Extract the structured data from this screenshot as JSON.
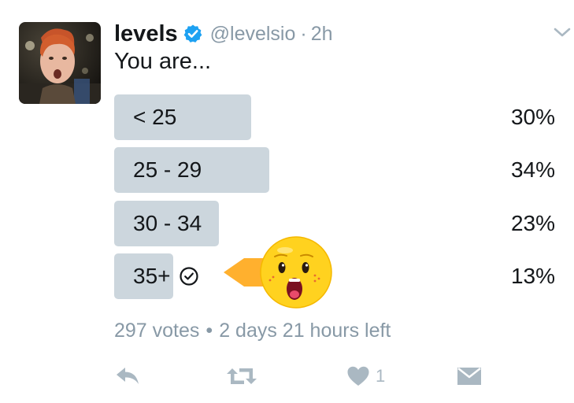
{
  "tweet": {
    "author_name": "levels",
    "author_handle": "@levelsio",
    "separator": "·",
    "time": "2h",
    "text": "You are..."
  },
  "poll": {
    "options": [
      {
        "label": "< 25",
        "percent_text": "30%",
        "fraction": 0.3,
        "selected": false
      },
      {
        "label": "25 - 29",
        "percent_text": "34%",
        "fraction": 0.34,
        "selected": false
      },
      {
        "label": "30 - 34",
        "percent_text": "23%",
        "fraction": 0.23,
        "selected": false
      },
      {
        "label": "35+",
        "percent_text": "13%",
        "fraction": 0.13,
        "selected": true
      }
    ],
    "votes": "297 votes",
    "bullet": "•",
    "time_left": "2 days 21 hours left"
  },
  "actions": {
    "like_count": "1"
  },
  "icons": {
    "verified": "verified-badge-icon",
    "caret": "chevron-down-icon",
    "selected": "check-circle-icon",
    "reply": "reply-icon",
    "retweet": "retweet-icon",
    "like": "heart-icon",
    "dm": "envelope-icon",
    "sticker": "surprised-face-sticker"
  },
  "colors": {
    "text": "#14171a",
    "muted": "#8899a6",
    "bar": "#ccd6dd",
    "verified": "#1da1f2",
    "action_icon": "#aab8c2",
    "sticker_face": "#ffd21f",
    "sticker_arrow": "#ffb02e"
  }
}
